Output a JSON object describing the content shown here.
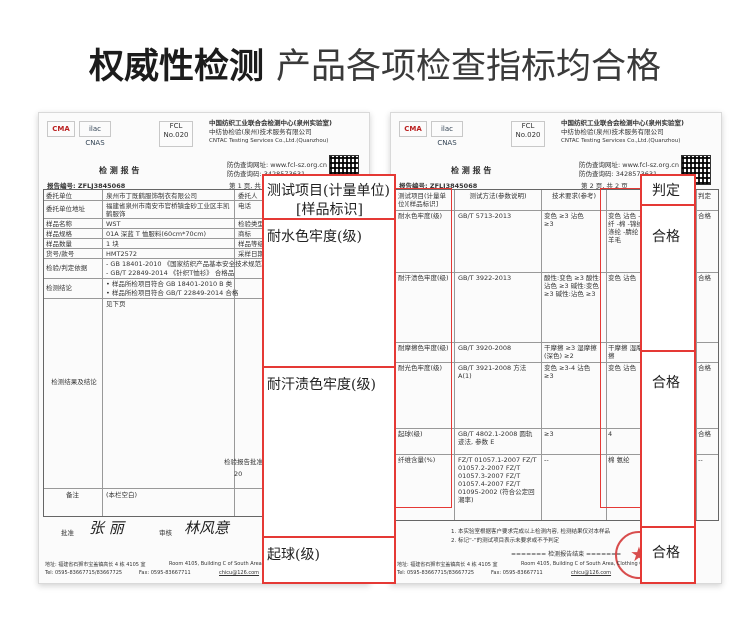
{
  "headline": {
    "bold": "权威性检测",
    "thin": "产品各项检查指标均合格"
  },
  "left_doc": {
    "org_cn": "中国纺织工业联合会检测中心(泉州实验室)",
    "org_cn2": "中纺协检验(泉州)技术服务有限公司",
    "org_en": "CNTAC Testing Services Co.,Ltd.(Quanzhou)",
    "report_title": "检 测 报 告",
    "anti_fake": "防伪查询网址: www.fcl-sz.org.cn",
    "anti_code": "防伪查询码: 3428573631",
    "report_no": "报告编号: ZFLJ3845068",
    "page": "第 1 页, 共",
    "rows": [
      {
        "label": "委托单位",
        "value": "泉州市丁既鹤服饰制衣有限公司",
        "extra": "委托人"
      },
      {
        "label": "委托单位地址",
        "value": "福建省泉州市南安市官桥镇金砂工业区丰凯鹤服饰",
        "extra": "电话"
      },
      {
        "label": "样品名称",
        "value": "WST",
        "extra": "检验类型"
      },
      {
        "label": "样品规格",
        "value": "01A 深蓝 T 恤服料(60cm*70cm)",
        "extra": "商标"
      },
      {
        "label": "样品数量",
        "value": "1 块",
        "extra": "样品等级"
      },
      {
        "label": "货号/款号",
        "value": "HMT2572",
        "extra": "采样日期"
      },
      {
        "label": "检验/判定依据",
        "value": "- GB 18401-2010 《国家纺织产品基本安全技术规范》B",
        "extra": ""
      },
      {
        "label": "",
        "value": "- GB/T 22849-2014 《针织T恤衫》 合格品",
        "extra": ""
      },
      {
        "label": "检测结论",
        "value": "• 样品所检项目符合 GB 18401-2010 B 类",
        "extra": ""
      },
      {
        "label": "",
        "value": "• 样品所检项目符合 GB/T 22849-2014 合格",
        "extra": ""
      }
    ],
    "see_below": "见下页",
    "result_label": "检测结果及结论",
    "date_text": "检验报告批准日期:",
    "date_val": "20",
    "remark_label": "备注",
    "remark_val": "(本栏空白)",
    "approve": "批准",
    "review": "审核",
    "sig1": "张 丽",
    "sig2": "林风意",
    "footer1": "地址: 福建省石狮市宝盖镇高长 4 栋 4105 室",
    "footer2": "Room 4105, Building C of South Area, Clothing City",
    "footer3": "Tel: 0595-83667715/83667725",
    "footer4": "Fax: 0595-83667711",
    "footer5": "chicu@126.com"
  },
  "right_doc": {
    "org_cn": "中国纺织工业联合会检测中心(泉州实验室)",
    "org_cn2": "中纺协检验(泉州)技术服务有限公司",
    "org_en": "CNTAC Testing Services Co.,Ltd.(Quanzhou)",
    "report_title": "检 测 报 告",
    "anti_fake": "防伪查询网址: www.fcl-sz.org.cn",
    "anti_code": "防伪查询码: 3428573631",
    "report_no": "报告编号: ZFLJ3845068",
    "page": "第 2 页, 共 2 页",
    "col_item": "测试项目(计量单位)[样品标识]",
    "col_method": "测试方法(参数说明)",
    "col_req": "技术要求(参考)",
    "col_measured": "测",
    "col_judge": "判定",
    "rows": [
      {
        "item": "耐水色牢度(级)",
        "method": "GB/T 5713-2013",
        "req": "变色 ≥3 沾色 ≥3",
        "meas": "变色 沾色 -醋纤 -棉 -锦纶 -涤纶 -腈纶 -羊毛",
        "judge": "合格"
      },
      {
        "item": "耐汗渍色牢度(级)",
        "method": "GB/T 3922-2013",
        "req": "酸性:变色 ≥3 酸性:沾色 ≥3 碱性:变色 ≥3 碱性:沾色 ≥3",
        "meas": "变色 沾色",
        "judge": "合格"
      },
      {
        "item": "耐摩擦色牢度(级)",
        "method": "GB/T 3920-2008",
        "req": "干摩擦 ≥3 湿摩擦(深色) ≥2",
        "meas": "干摩擦 湿摩擦",
        "judge": ""
      },
      {
        "item": "耐光色牢度(级)",
        "method": "GB/T 3921-2008 方法 A(1)",
        "req": "变色 ≥3-4 沾色 ≥3",
        "meas": "变色 沾色",
        "judge": "合格"
      },
      {
        "item": "起球(级)",
        "method": "GB/T 4802.1-2008 圆轨迹法, 参数 E",
        "req": "≥3",
        "meas": "4",
        "judge": "合格"
      },
      {
        "item": "纤维含量(%)",
        "method": "FZ/T 01057.1-2007 FZ/T 01057.2-2007 FZ/T 01057.3-2007 FZ/T 01057.4-2007 FZ/T 01095-2002 (符合公定回潮率)",
        "req": "--",
        "meas": "棉 氨纶",
        "judge": "--"
      }
    ],
    "note1": "1. 本实验室根据客户要求完成以上检测内容, 检测结果仅对本样品",
    "note2": "2. 标记“-”的测试项目表示未要求或不予判定",
    "end_text": "======= 检测报告结束 =======",
    "footer1": "地址: 福建省石狮市宝盖镇高长 4 栋 4105 室",
    "footer2": "Room 4105, Building C of South Area, Clothing City",
    "footer3": "Tel: 0595-83667715/83667725",
    "footer4": "Fax: 0595-83667711",
    "footer5": "chicu@126.com"
  },
  "highlight_left": {
    "header_line1": "测试项目(计量单位)",
    "header_line2": "[样品标识]",
    "item1": "耐水色牢度(级)",
    "item2": "耐汗渍色牢度(级)",
    "item3": "起球(级)"
  },
  "highlight_right": {
    "header": "判定",
    "result1": "合格",
    "result2": "合格",
    "result3": "合格"
  },
  "colors": {
    "accent_red": "#e53935",
    "text_dark": "#1c1c1c"
  }
}
